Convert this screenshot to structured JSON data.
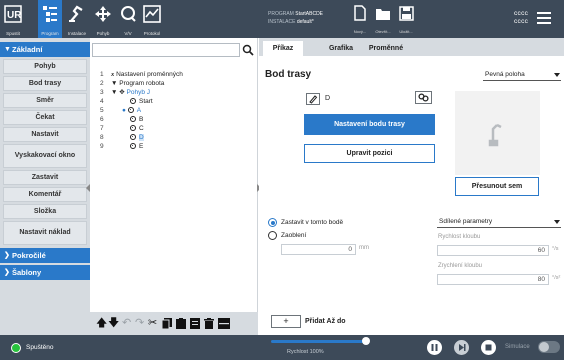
{
  "topbar": {
    "buttons": [
      {
        "label": "Spustit",
        "icon": "ur-logo-icon"
      },
      {
        "label": "Program",
        "icon": "program-icon"
      },
      {
        "label": "Instalace",
        "icon": "installation-icon"
      },
      {
        "label": "Pohyb",
        "icon": "move-icon"
      },
      {
        "label": "V/V",
        "icon": "io-icon"
      },
      {
        "label": "Protokol",
        "icon": "log-icon"
      }
    ],
    "program_key": "PROGRAM",
    "program_value": "StartABCDE",
    "installation_key": "INSTALACE",
    "installation_value": "default*",
    "file_buttons": [
      {
        "label": "Nový...",
        "icon": "new-file-icon"
      },
      {
        "label": "Otevřít...",
        "icon": "open-folder-icon"
      },
      {
        "label": "Uložit...",
        "icon": "save-icon"
      }
    ],
    "user_line1": "cccc",
    "user_line2": "cccc"
  },
  "leftnav": {
    "basic_header": "Základní",
    "items": [
      "Pohyb",
      "Bod trasy",
      "Směr",
      "Čekat",
      "Nastavit",
      "Vyskakovací okno",
      "Zastavit",
      "Komentář",
      "Složka",
      "Nastavit náklad"
    ],
    "advanced_header": "Pokročilé",
    "templates_header": "Šablony"
  },
  "tree": {
    "rows": [
      {
        "num": "1",
        "text": "Nastavení proměnných"
      },
      {
        "num": "2",
        "text": "Program robota"
      },
      {
        "num": "3",
        "text": "Pohyb J"
      },
      {
        "num": "4",
        "text": "Start"
      },
      {
        "num": "5",
        "text": "A"
      },
      {
        "num": "6",
        "text": "B"
      },
      {
        "num": "7",
        "text": "C"
      },
      {
        "num": "8",
        "text": "D"
      },
      {
        "num": "9",
        "text": "E"
      }
    ]
  },
  "tabs": [
    "Příkaz",
    "Grafika",
    "Proměnné"
  ],
  "waypoint": {
    "title": "Bod trasy",
    "position_type": "Pevná poloha",
    "name": "D",
    "set_waypoint_label": "Nastavení bodu trasy",
    "edit_position_label": "Upravit pozici",
    "move_here_label": "Přesunout sem",
    "stop_at_label": "Zastavit v tomto bodě",
    "blend_label": "Zaoblení",
    "blend_value": "0",
    "blend_unit": "mm",
    "params_select": "Sdílené parametry",
    "joint_speed_label": "Rychlost kloubu",
    "joint_speed_value": "60",
    "joint_speed_unit": "°/s",
    "joint_accel_label": "Zrychlení kloubu",
    "joint_accel_value": "80",
    "joint_accel_unit": "°/s²",
    "add_until_label": "Přidat Až do",
    "add_until_symbol": "+"
  },
  "bottombar": {
    "status": "Spuštěno",
    "speed_label": "Rychlost 100%",
    "speed_fraction": 1.0,
    "simulation_label": "Simulace"
  },
  "colors": {
    "accent": "#2a79c9",
    "bar": "#3d4a59",
    "running": "#27c33c"
  }
}
